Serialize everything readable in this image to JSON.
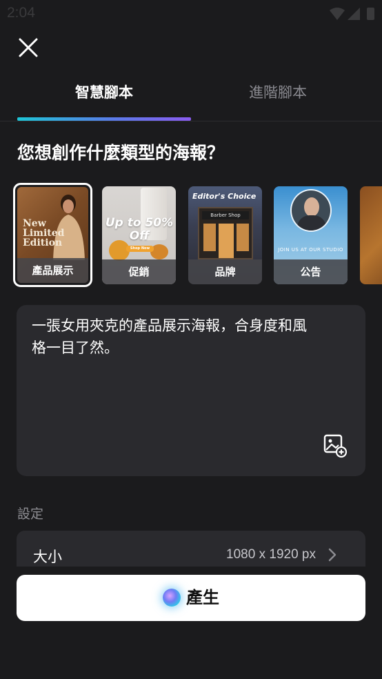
{
  "status_bar": {
    "time": "2:04"
  },
  "tabs": [
    {
      "label": "智慧腳本",
      "active": true
    },
    {
      "label": "進階腳本",
      "active": false
    }
  ],
  "question": "您想創作什麼類型的海報？",
  "templates": [
    {
      "label": "產品展示",
      "selected": true,
      "art_text": "New Limited Edition"
    },
    {
      "label": "促銷",
      "selected": false,
      "art_text": "Up to 50% Off",
      "art_button": "Shop Now"
    },
    {
      "label": "品牌",
      "selected": false,
      "art_text": "Editor's Choice",
      "art_sign": "Barber Shop"
    },
    {
      "label": "公告",
      "selected": false,
      "art_text": "JOIN US AT OUR STUDIO"
    }
  ],
  "prompt": {
    "text": "一張女用夾克的產品展示海報，合身度和風格一目了然。"
  },
  "settings": {
    "section_label": "設定",
    "size_label": "大小",
    "size_value": "1080 x 1920 px"
  },
  "generate_label": "產生",
  "colors": {
    "background": "#1b1b1d",
    "card": "#2a2a2e",
    "tab_underline_start": "#1ec6d6",
    "tab_underline_end": "#8a5cf0"
  }
}
